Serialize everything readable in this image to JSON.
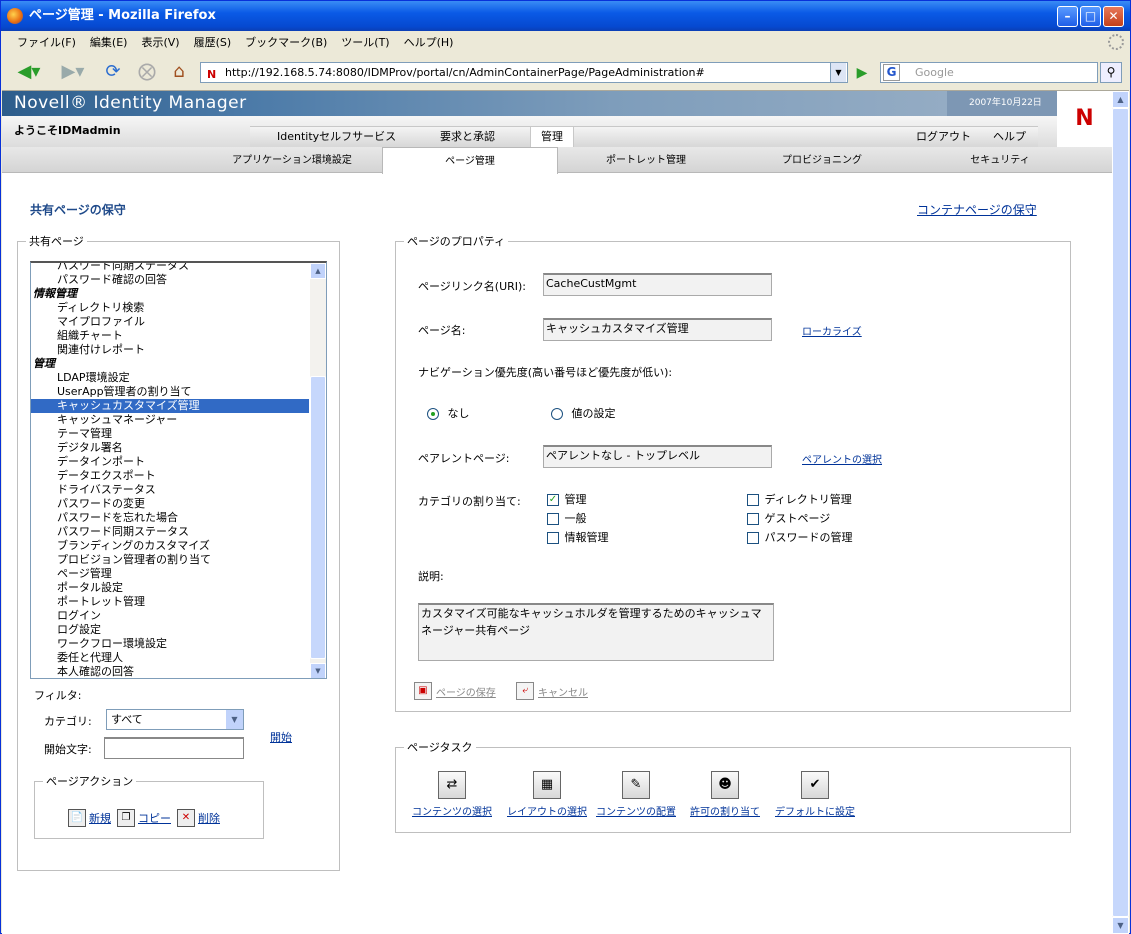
{
  "window": {
    "title": "ページ管理 - Mozilla Firefox"
  },
  "menu": [
    "ファイル(F)",
    "編集(E)",
    "表示(V)",
    "履歴(S)",
    "ブックマーク(B)",
    "ツール(T)",
    "ヘルプ(H)"
  ],
  "toolbar": {
    "url": "http://192.168.5.74:8080/IDMProv/portal/cn/AdminContainerPage/PageAdministration#",
    "search_placeholder": "Google"
  },
  "header": {
    "brand": "Novell® Identity Manager",
    "date": "2007年10月22日",
    "welcome": "ようこそIDMadmin",
    "logo_letter": "N"
  },
  "main_tabs": [
    {
      "label": "Identityセルフサービス",
      "active": false
    },
    {
      "label": "要求と承認",
      "active": false
    },
    {
      "label": "管理",
      "active": true
    },
    {
      "label": "ログアウト",
      "active": false
    },
    {
      "label": "ヘルプ",
      "active": false
    }
  ],
  "sub_tabs": [
    {
      "label": "アプリケーション環境設定",
      "active": false
    },
    {
      "label": "ページ管理",
      "active": true
    },
    {
      "label": "ポートレット管理",
      "active": false
    },
    {
      "label": "プロビジョニング",
      "active": false
    },
    {
      "label": "セキュリティ",
      "active": false
    }
  ],
  "page": {
    "section_title": "共有ページの保守",
    "container_link": "コンテナページの保守"
  },
  "shared_pages": {
    "legend": "共有ページ",
    "items": [
      {
        "label": "パスワード同期ステータス",
        "type": "item"
      },
      {
        "label": "パスワード確認の回答",
        "type": "item"
      },
      {
        "label": "情報管理",
        "type": "group"
      },
      {
        "label": "ディレクトリ検索",
        "type": "item"
      },
      {
        "label": "マイプロファイル",
        "type": "item"
      },
      {
        "label": "組織チャート",
        "type": "item"
      },
      {
        "label": "関連付けレポート",
        "type": "item"
      },
      {
        "label": "管理",
        "type": "group"
      },
      {
        "label": "LDAP環境設定",
        "type": "item"
      },
      {
        "label": "UserApp管理者の割り当て",
        "type": "item"
      },
      {
        "label": "キャッシュカスタマイズ管理",
        "type": "item",
        "selected": true
      },
      {
        "label": "キャッシュマネージャー",
        "type": "item"
      },
      {
        "label": "テーマ管理",
        "type": "item"
      },
      {
        "label": "デジタル署名",
        "type": "item"
      },
      {
        "label": "データインポート",
        "type": "item"
      },
      {
        "label": "データエクスポート",
        "type": "item"
      },
      {
        "label": "ドライバステータス",
        "type": "item"
      },
      {
        "label": "パスワードの変更",
        "type": "item"
      },
      {
        "label": "パスワードを忘れた場合",
        "type": "item"
      },
      {
        "label": "パスワード同期ステータス",
        "type": "item"
      },
      {
        "label": "ブランディングのカスタマイズ",
        "type": "item"
      },
      {
        "label": "プロビジョン管理者の割り当て",
        "type": "item"
      },
      {
        "label": "ページ管理",
        "type": "item"
      },
      {
        "label": "ポータル設定",
        "type": "item"
      },
      {
        "label": "ポートレット管理",
        "type": "item"
      },
      {
        "label": "ログイン",
        "type": "item"
      },
      {
        "label": "ログ設定",
        "type": "item"
      },
      {
        "label": "ワークフロー環境設定",
        "type": "item"
      },
      {
        "label": "委任と代理人",
        "type": "item"
      },
      {
        "label": "本人確認の回答",
        "type": "item"
      }
    ],
    "filter_label": "フィルタ:",
    "category_label": "カテゴリ:",
    "category_value": "すべて",
    "start_label": "開始文字:",
    "start_value": "",
    "start_link": "開始"
  },
  "page_actions": {
    "legend": "ページアクション",
    "new": "新規",
    "copy": "コピー",
    "delete": "削除"
  },
  "properties": {
    "legend": "ページのプロパティ",
    "uri_label": "ページリンク名(URI):",
    "uri_value": "CacheCustMgmt",
    "name_label": "ページ名:",
    "name_value": "キャッシュカスタマイズ管理",
    "localize_link": "ローカライズ",
    "nav_priority_label": "ナビゲーション優先度(高い番号ほど優先度が低い):",
    "radio_none": "なし",
    "radio_set": "値の設定",
    "parent_label": "ペアレントページ:",
    "parent_value": "ペアレントなし - トップレベル",
    "parent_link": "ペアレントの選択",
    "category_assign_label": "カテゴリの割り当て:",
    "categories": [
      {
        "label": "管理",
        "checked": true
      },
      {
        "label": "一般",
        "checked": false
      },
      {
        "label": "情報管理",
        "checked": false
      },
      {
        "label": "ディレクトリ管理",
        "checked": false
      },
      {
        "label": "ゲストページ",
        "checked": false
      },
      {
        "label": "パスワードの管理",
        "checked": false
      }
    ],
    "description_label": "説明:",
    "description_value": "カスタマイズ可能なキャッシュホルダを管理するためのキャッシュマネージャー共有ページ",
    "save_button": "ページの保存",
    "cancel_button": "キャンセル"
  },
  "page_tasks": {
    "legend": "ページタスク",
    "tasks": [
      "コンテンツの選択",
      "レイアウトの選択",
      "コンテンツの配置",
      "許可の割り当て",
      "デフォルトに設定"
    ]
  }
}
